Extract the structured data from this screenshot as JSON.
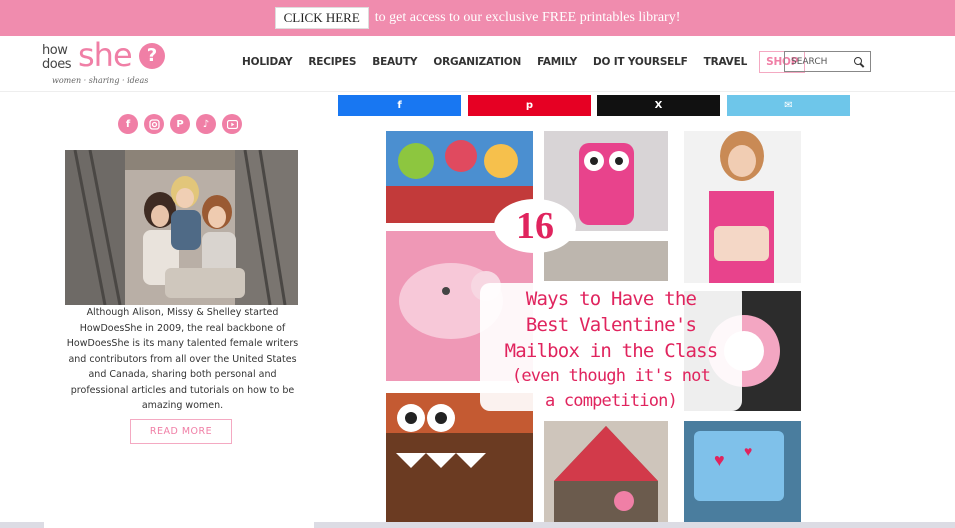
{
  "promo": {
    "button_label": "CLICK HERE",
    "text": "to get access to our exclusive FREE printables library!"
  },
  "logo": {
    "how": "how",
    "does": "does",
    "she": "she",
    "q": "?",
    "tagline": "women · sharing · ideas"
  },
  "nav": {
    "items": [
      "HOLIDAY",
      "RECIPES",
      "BEAUTY",
      "ORGANIZATION",
      "FAMILY",
      "DO IT YOURSELF",
      "TRAVEL"
    ],
    "shop": "SHOP"
  },
  "search": {
    "placeholder": "SEARCH"
  },
  "sidebar": {
    "socials": [
      "facebook-icon",
      "instagram-icon",
      "pinterest-icon",
      "tiktok-icon",
      "youtube-icon"
    ],
    "bio": "Although Alison, Missy & Shelley started HowDoesShe in 2009, the real backbone of HowDoesShe is its many talented female writers and contributors from all over the United States and Canada, sharing both personal and professional articles and tutorials on how to be amazing women.",
    "read_more": "READ MORE"
  },
  "share": {
    "fb": "f",
    "pin": "p",
    "x": "X",
    "mail": "✉"
  },
  "post_image": {
    "number": "16",
    "line1": "Ways to Have the",
    "line2": "Best Valentine's",
    "line3": "Mailbox in the Class",
    "line4": "(even though it's not",
    "line5": "a competition)"
  },
  "colors": {
    "brand_pink": "#f07fa6",
    "banner_pink": "#f08cae",
    "facebook": "#1877f2",
    "pinterest": "#e60023",
    "x": "#111111",
    "email": "#6ec6ea"
  }
}
